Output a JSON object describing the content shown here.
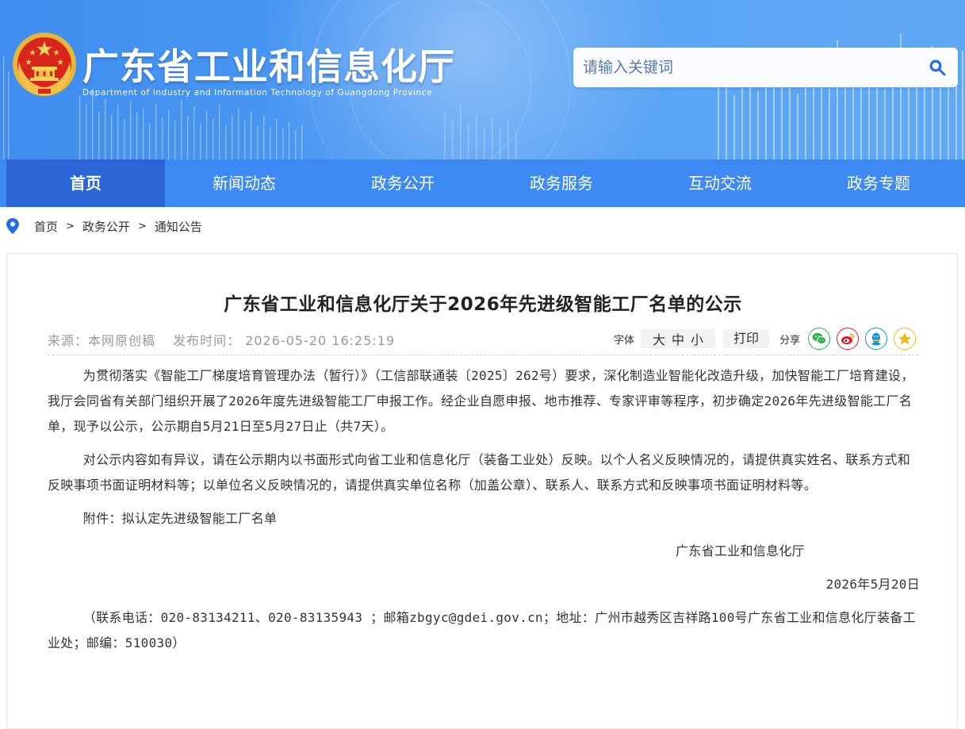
{
  "header": {
    "title": "广东省工业和信息化厅",
    "subtitle": "Department of Industry and Information Technology of Guangdong Province",
    "search_placeholder": "请输入关键词"
  },
  "nav": {
    "items": [
      {
        "label": "首页",
        "active": true
      },
      {
        "label": "新闻动态",
        "active": false
      },
      {
        "label": "政务公开",
        "active": false
      },
      {
        "label": "政务服务",
        "active": false
      },
      {
        "label": "互动交流",
        "active": false
      },
      {
        "label": "政务专题",
        "active": false
      }
    ]
  },
  "breadcrumb": {
    "items": [
      "首页",
      "政务公开",
      "通知公告"
    ],
    "separator": ">"
  },
  "article": {
    "title": "广东省工业和信息化厅关于2026年先进级智能工厂名单的公示",
    "source": "来源：本网原创稿",
    "publish_time": "发布时间： 2026-05-20 16:25:19",
    "tools": {
      "font_label": "字体",
      "size_large": "大",
      "size_medium": "中",
      "size_small": "小",
      "print_label": "打印",
      "share_label": "分享"
    },
    "share_icons": [
      "wechat-icon",
      "weibo-icon",
      "qq-icon",
      "qzone-icon"
    ],
    "paragraphs": [
      "为贯彻落实《智能工厂梯度培育管理办法（暂行）》（工信部联通装〔2025〕262号）要求，深化制造业智能化改造升级，加快智能工厂培育建设，我厅会同省有关部门组织开展了2026年度先进级智能工厂申报工作。经企业自愿申报、地市推荐、专家评审等程序，初步确定2026年先进级智能工厂名单，现予以公示，公示期自5月21日至5月27日止（共7天）。",
      "对公示内容如有异议，请在公示期内以书面形式向省工业和信息化厅（装备工业处）反映。以个人名义反映情况的，请提供真实姓名、联系方式和反映事项书面证明材料等；以单位名义反映情况的，请提供真实单位名称（加盖公章）、联系人、联系方式和反映事项书面证明材料等。"
    ],
    "attachment": "附件：拟认定先进级智能工厂名单",
    "signature": "广东省工业和信息化厅",
    "date": "2026年5月20日",
    "contact": "（联系电话：020-83134211、020-83135943 ；邮箱zbgyc@gdei.gov.cn；地址：广州市越秀区吉祥路100号广东省工业和信息化厅装备工业处；邮编：510030）"
  },
  "colors": {
    "header_blue": "#4c9af3",
    "nav_blue": "#3d8af5",
    "nav_active": "#2c66d6",
    "wechat_green": "#2bb24c",
    "weibo_red": "#e6162d",
    "qq_blue": "#1296db",
    "qzone_yellow": "#f5b60f"
  }
}
